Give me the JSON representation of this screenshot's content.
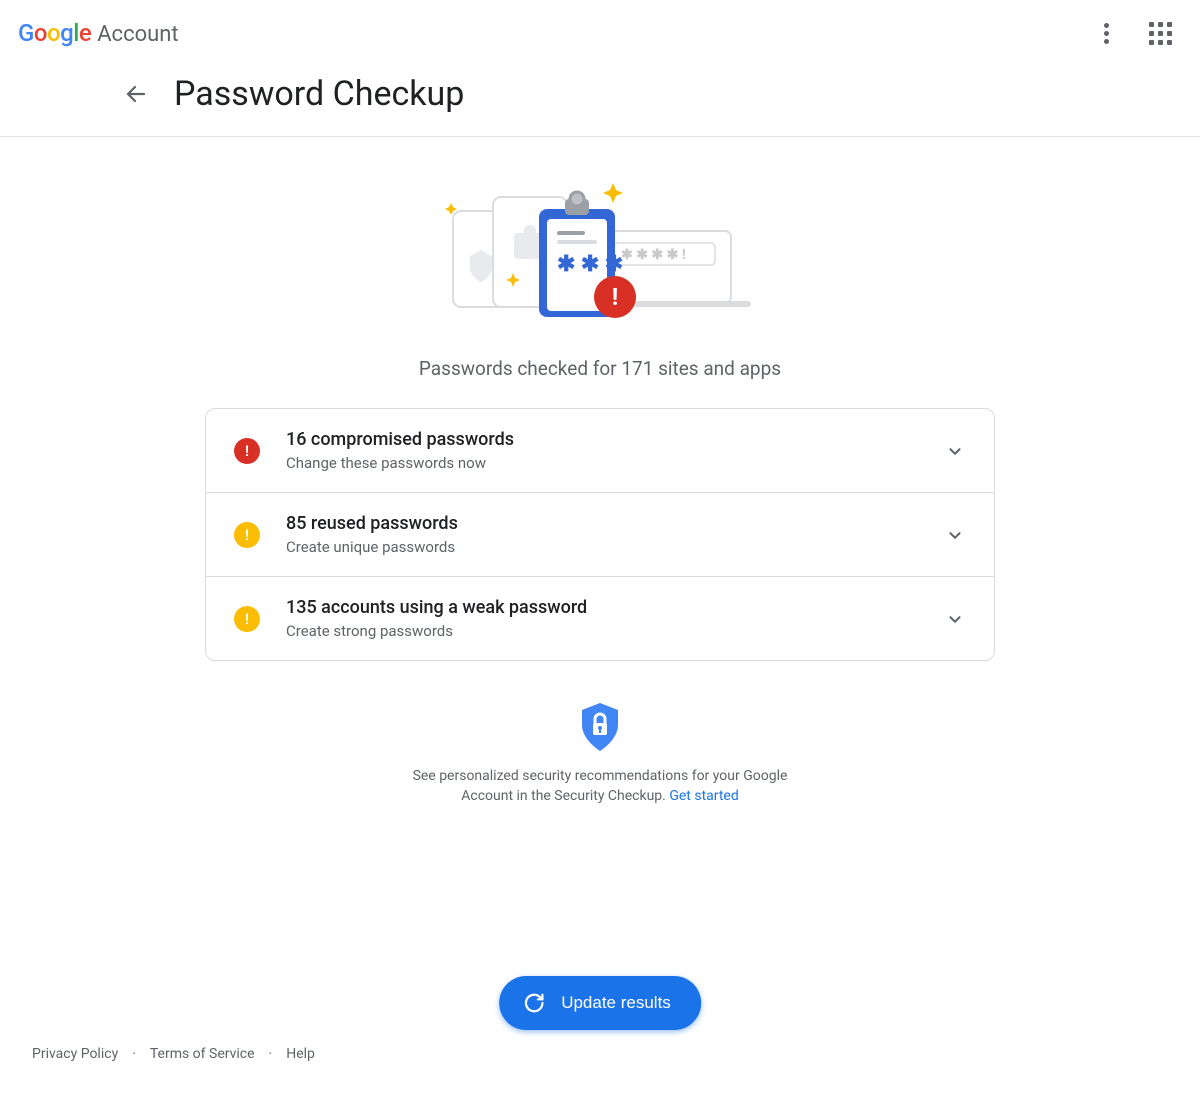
{
  "header": {
    "product": "Account",
    "page_title": "Password Checkup"
  },
  "summary_line": "Passwords checked for 171 sites and apps",
  "results": [
    {
      "title": "16 compromised passwords",
      "subtitle": "Change these passwords now",
      "severity": "red"
    },
    {
      "title": "85 reused passwords",
      "subtitle": "Create unique passwords",
      "severity": "yellow"
    },
    {
      "title": "135 accounts using a weak password",
      "subtitle": "Create strong passwords",
      "severity": "yellow"
    }
  ],
  "promo": {
    "text": "See personalized security recommendations for your Google Account in the Security Checkup. ",
    "link_label": "Get started"
  },
  "update_button": "Update results",
  "footer": {
    "privacy": "Privacy Policy",
    "terms": "Terms of Service",
    "help": "Help"
  }
}
